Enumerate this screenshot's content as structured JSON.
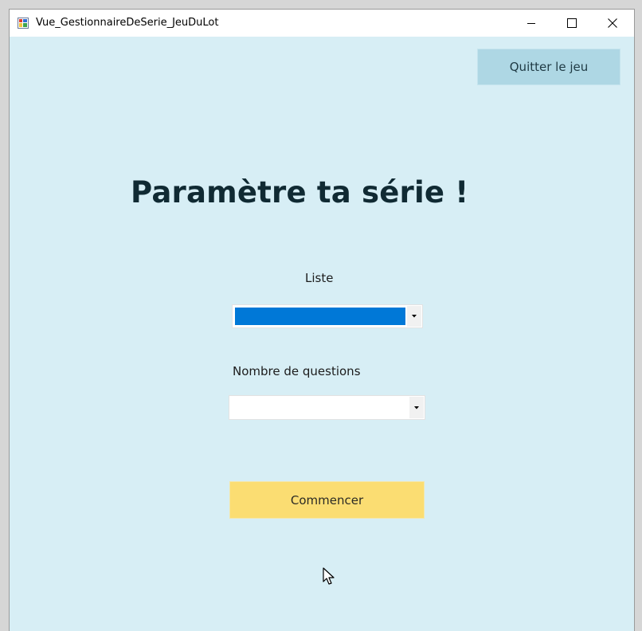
{
  "window": {
    "title": "Vue_GestionnaireDeSerie_JeuDuLot",
    "controls": [
      "minimize-icon",
      "maximize-icon",
      "close-icon"
    ]
  },
  "header": {
    "quit_label": "Quitter le jeu"
  },
  "main": {
    "heading": "Paramètre ta série !",
    "liste_label": "Liste",
    "liste_value": "",
    "nombre_label": "Nombre de questions",
    "nombre_value": "",
    "start_label": "Commencer"
  },
  "colors": {
    "background": "#d7eef5",
    "quit_button": "#aed7e4",
    "start_button": "#fbdd72",
    "selection": "#0078d7",
    "heading": "#102a33"
  }
}
